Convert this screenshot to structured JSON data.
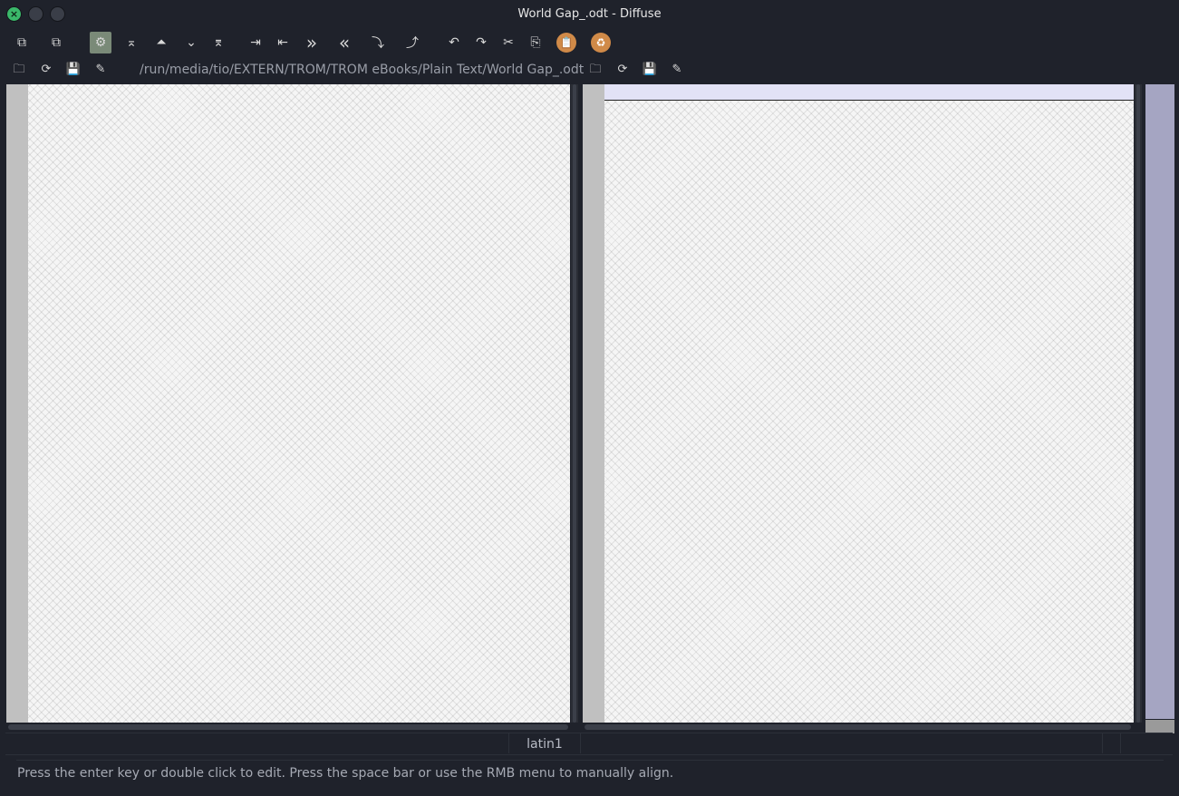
{
  "window": {
    "title": "World Gap_.odt - Diffuse",
    "buttons": [
      "close",
      "minimize",
      "maximize"
    ]
  },
  "toolbar": {
    "items": [
      {
        "name": "new-2-way-merge-icon",
        "glyph": "⧉"
      },
      {
        "name": "new-3-way-merge-icon",
        "glyph": "⧉"
      },
      {
        "name": "realign-all-icon",
        "glyph": "⚙"
      },
      {
        "name": "first-difference-icon",
        "glyph": "⌅"
      },
      {
        "name": "previous-difference-icon",
        "glyph": "⏶"
      },
      {
        "name": "next-difference-icon",
        "glyph": "⌄"
      },
      {
        "name": "last-difference-icon",
        "glyph": "⌆"
      },
      {
        "name": "shift-pane-right-icon",
        "glyph": "⇥"
      },
      {
        "name": "shift-pane-left-icon",
        "glyph": "⇤"
      },
      {
        "name": "copy-selection-right-icon",
        "glyph": "»"
      },
      {
        "name": "copy-selection-left-icon",
        "glyph": "«"
      },
      {
        "name": "copy-left-into-selection-icon",
        "glyph": "⤵"
      },
      {
        "name": "copy-right-into-selection-icon",
        "glyph": "⤴"
      },
      {
        "name": "undo-icon",
        "glyph": "↶"
      },
      {
        "name": "redo-icon",
        "glyph": "↷"
      },
      {
        "name": "cut-icon",
        "glyph": "✂"
      },
      {
        "name": "copy-icon",
        "glyph": "⎘"
      },
      {
        "name": "paste-icon",
        "glyph": "📋"
      },
      {
        "name": "merge-icon",
        "glyph": "♻"
      }
    ]
  },
  "left_pane": {
    "path": "/run/media/tio/EXTERN/TROM/TROM eBooks/Plain Text/World Gap_.odt",
    "icons": [
      {
        "name": "open-file-icon",
        "glyph": "🗀"
      },
      {
        "name": "reload-file-icon",
        "glyph": "⟳"
      },
      {
        "name": "save-file-icon",
        "glyph": "💾"
      },
      {
        "name": "save-as-icon",
        "glyph": "✎"
      }
    ]
  },
  "right_pane": {
    "path": "",
    "icons": [
      {
        "name": "open-file-icon",
        "glyph": "🗀"
      },
      {
        "name": "reload-file-icon",
        "glyph": "⟳"
      },
      {
        "name": "save-file-icon",
        "glyph": "💾"
      },
      {
        "name": "save-as-icon",
        "glyph": "✎"
      }
    ]
  },
  "status": {
    "encoding": "latin1",
    "hint": "Press the enter key or double click to edit. Press the space bar or use the RMB menu to manually align."
  },
  "colors": {
    "background": "#1f222b",
    "gutter": "#c0c0c0",
    "overview": "#a5a5c2",
    "selected_line": "#e2e2f6",
    "close_button": "#3bb86a",
    "orange_icon": "#d08a48"
  }
}
